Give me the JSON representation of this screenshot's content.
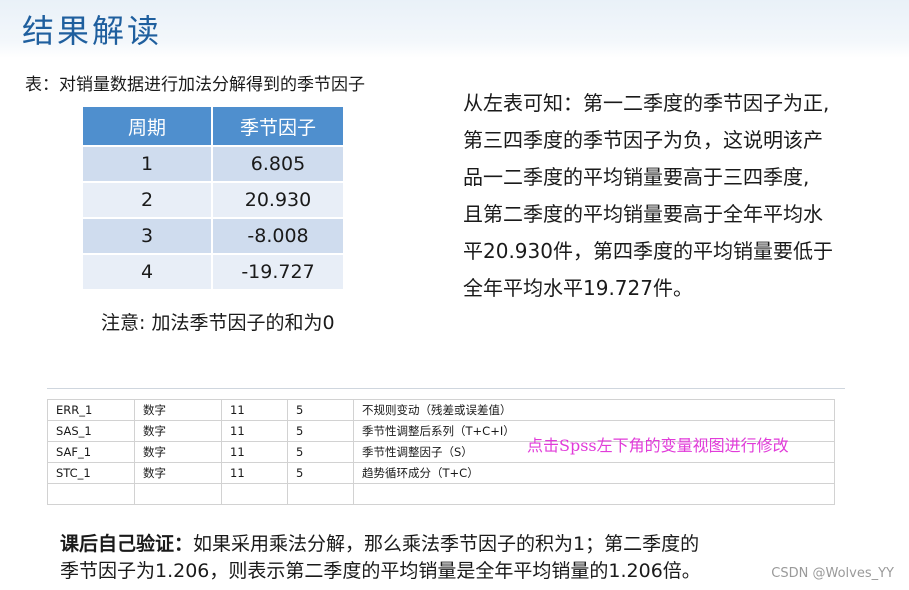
{
  "slide": {
    "title": "结果解读"
  },
  "table": {
    "caption": "表：对销量数据进行加法分解得到的季节因子",
    "headers": [
      "周期",
      "季节因子"
    ],
    "rows": [
      [
        "1",
        "6.805"
      ],
      [
        "2",
        "20.930"
      ],
      [
        "3",
        "-8.008"
      ],
      [
        "4",
        "-19.727"
      ]
    ],
    "note": "注意: 加法季节因子的和为0"
  },
  "conclusion": {
    "lines": [
      "从左表可知：第一二季度的季节因子为正,",
      "第三四季度的季节因子为负，这说明该产",
      "品一二季度的平均销量要高于三四季度,",
      "且第二季度的平均销量要高于全年平均水",
      "平20.930件，第四季度的平均销量要低于",
      "全年平均水平19.727件。"
    ]
  },
  "spss": {
    "rows": [
      [
        "ERR_1",
        "数字",
        "11",
        "5",
        "不规则变动（残差或误差值）"
      ],
      [
        "SAS_1",
        "数字",
        "11",
        "5",
        "季节性调整后系列（T+C+I）"
      ],
      [
        "SAF_1",
        "数字",
        "11",
        "5",
        "季节性调整因子（S）"
      ],
      [
        "STC_1",
        "数字",
        "11",
        "5",
        "趋势循环成分（T+C）"
      ]
    ],
    "annotation": "点击Spss左下角的变量视图进行修改"
  },
  "exercise": {
    "label": "课后自己验证：",
    "line1_rest": "如果采用乘法分解，那么乘法季节因子的积为1；第二季度的",
    "line2": "季节因子为1.206，则表示第二季度的平均销量是全年平均销量的1.206倍。"
  },
  "watermark": "CSDN @Wolves_YY",
  "colors": {
    "title": "#1f5f9e",
    "table_header": "#4f8fce",
    "row_dark": "#cfdcee",
    "row_light": "#e8eef7",
    "annotation": "#e13bd9"
  }
}
